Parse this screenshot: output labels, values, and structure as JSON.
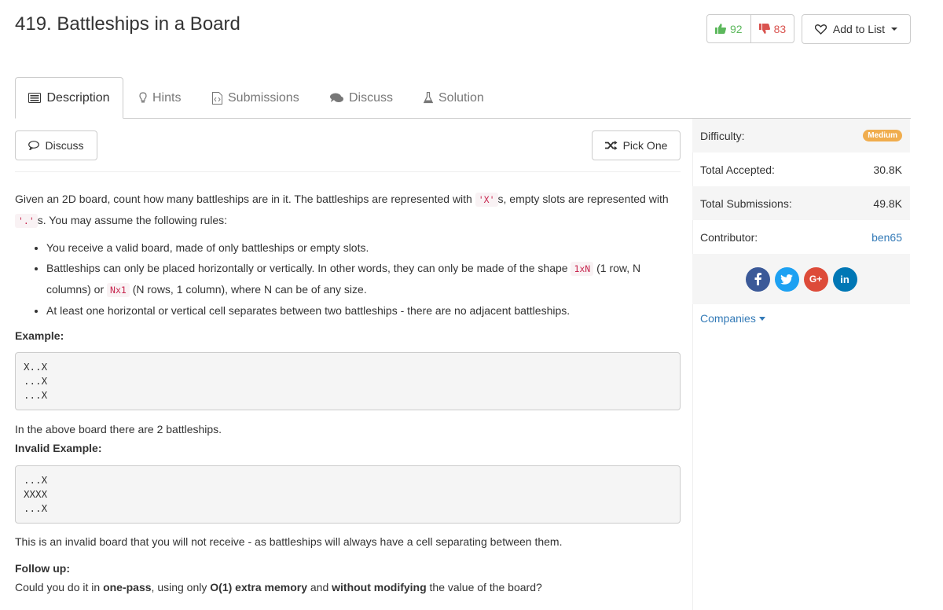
{
  "problem": {
    "title": "419. Battleships in a Board"
  },
  "votes": {
    "up": "92",
    "down": "83"
  },
  "add_to_list": "Add to List",
  "tabs": [
    {
      "label": "Description",
      "icon": "description-icon"
    },
    {
      "label": "Hints",
      "icon": "lightbulb-icon"
    },
    {
      "label": "Submissions",
      "icon": "code-file-icon"
    },
    {
      "label": "Discuss",
      "icon": "chat-icon"
    },
    {
      "label": "Solution",
      "icon": "flask-icon"
    }
  ],
  "actions": {
    "discuss": "Discuss",
    "pick_one": "Pick One"
  },
  "description": {
    "intro_1": "Given an 2D board, count how many battleships are in it. The battleships are represented with ",
    "code_x": "'X'",
    "intro_2": "s, empty slots are represented with ",
    "code_dot": "'.'",
    "intro_3": "s. You may assume the following rules:",
    "rule_1": "You receive a valid board, made of only battleships or empty slots.",
    "rule_2a": "Battleships can only be placed horizontally or vertically. In other words, they can only be made of the shape ",
    "code_1xn": "1xN",
    "rule_2b": " (1 row, N columns) or ",
    "code_nx1": "Nx1",
    "rule_2c": " (N rows, 1 column), where N can be of any size.",
    "rule_3": "At least one horizontal or vertical cell separates between two battleships - there are no adjacent battleships.",
    "example_label": "Example:",
    "example_board": "X..X\n...X\n...X",
    "example_text": "In the above board there are 2 battleships.",
    "invalid_label": "Invalid Example:",
    "invalid_board": "...X\nXXXX\n...X",
    "invalid_text": "This is an invalid board that you will not receive - as battleships will always have a cell separating between them.",
    "followup_label": "Follow up:",
    "followup_1": "Could you do it in ",
    "followup_b1": "one-pass",
    "followup_2": ", using only ",
    "followup_b2": "O(1) extra memory",
    "followup_3": " and ",
    "followup_b3": "without modifying",
    "followup_4": " the value of the board?"
  },
  "sidebar": {
    "difficulty_label": "Difficulty:",
    "difficulty_value": "Medium",
    "accepted_label": "Total Accepted:",
    "accepted_value": "30.8K",
    "submissions_label": "Total Submissions:",
    "submissions_value": "49.8K",
    "contributor_label": "Contributor:",
    "contributor_value": "ben65",
    "companies": "Companies",
    "social": [
      {
        "name": "facebook-icon",
        "glyph": "f",
        "color": "#3b5998"
      },
      {
        "name": "twitter-icon",
        "glyph": "t",
        "color": "#1da1f2"
      },
      {
        "name": "google-plus-icon",
        "glyph": "G+",
        "color": "#dd4b39"
      },
      {
        "name": "linkedin-icon",
        "glyph": "in",
        "color": "#0077b5"
      }
    ]
  },
  "colors": {
    "accent": "#337ab7",
    "medium_badge": "#f0ad4e",
    "upvote": "#5cb85c",
    "downvote": "#d9534f"
  }
}
